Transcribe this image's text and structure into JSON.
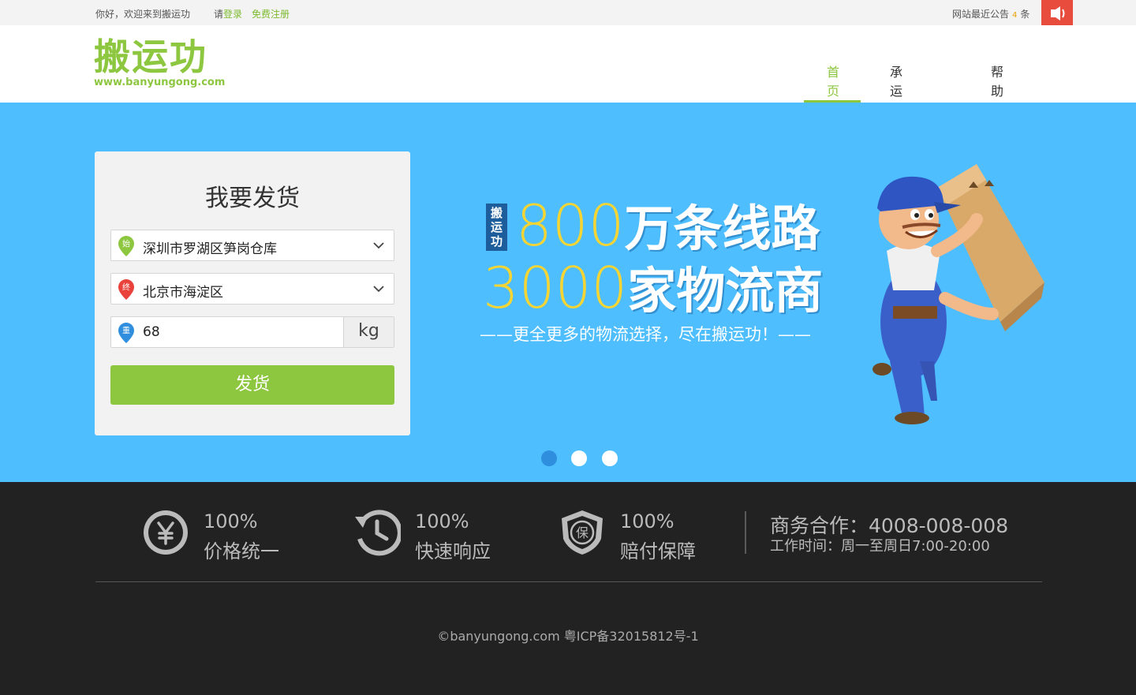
{
  "topbar": {
    "greeting": "你好，欢迎来到搬运功",
    "login_prefix": "请",
    "login_label": "登录",
    "register_label": "免费注册",
    "notice_prefix": "网站最近公告",
    "notice_count": "4",
    "notice_suffix": "条",
    "notice_icon": "speaker-icon",
    "notice_color": "#e74c3c"
  },
  "header": {
    "logo_cn": "搬运功",
    "logo_en": "www.banyungong.com",
    "nav": [
      {
        "label": "首页",
        "active": true
      },
      {
        "label": "承运商入驻",
        "active": false
      },
      {
        "label": "帮助中心",
        "active": false
      }
    ],
    "accent_color": "#8dc63f"
  },
  "form": {
    "title": "我要发货",
    "origin_badge": "始",
    "origin": "深圳市罗湖区笋岗仓库",
    "destination_badge": "终",
    "destination": "北京市海淀区",
    "weight_badge": "重",
    "weight": "68",
    "weight_unit": "kg",
    "submit_label": "发货"
  },
  "banner": {
    "tag": "搬运功",
    "line1_num": "800",
    "line1_text": "万条线路",
    "line2_num": "3000",
    "line2_text": "家物流商",
    "subtitle": "——更全更多的物流选择，尽在搬运功！——",
    "background": "#4ebeff",
    "slides_total": 3,
    "active_slide": 1
  },
  "footer": {
    "features": [
      {
        "icon": "yen-icon",
        "pct": "100%",
        "text": "价格统一"
      },
      {
        "icon": "clock-icon",
        "pct": "100%",
        "text": "快速响应"
      },
      {
        "icon": "shield-icon",
        "pct": "100%",
        "text": "赔付保障"
      }
    ],
    "contact": "商务合作：4008-008-008",
    "hours": "工作时间：周一至周日7:00-20:00",
    "copyright": "©banyungong.com  粤ICP备32015812号-1"
  }
}
